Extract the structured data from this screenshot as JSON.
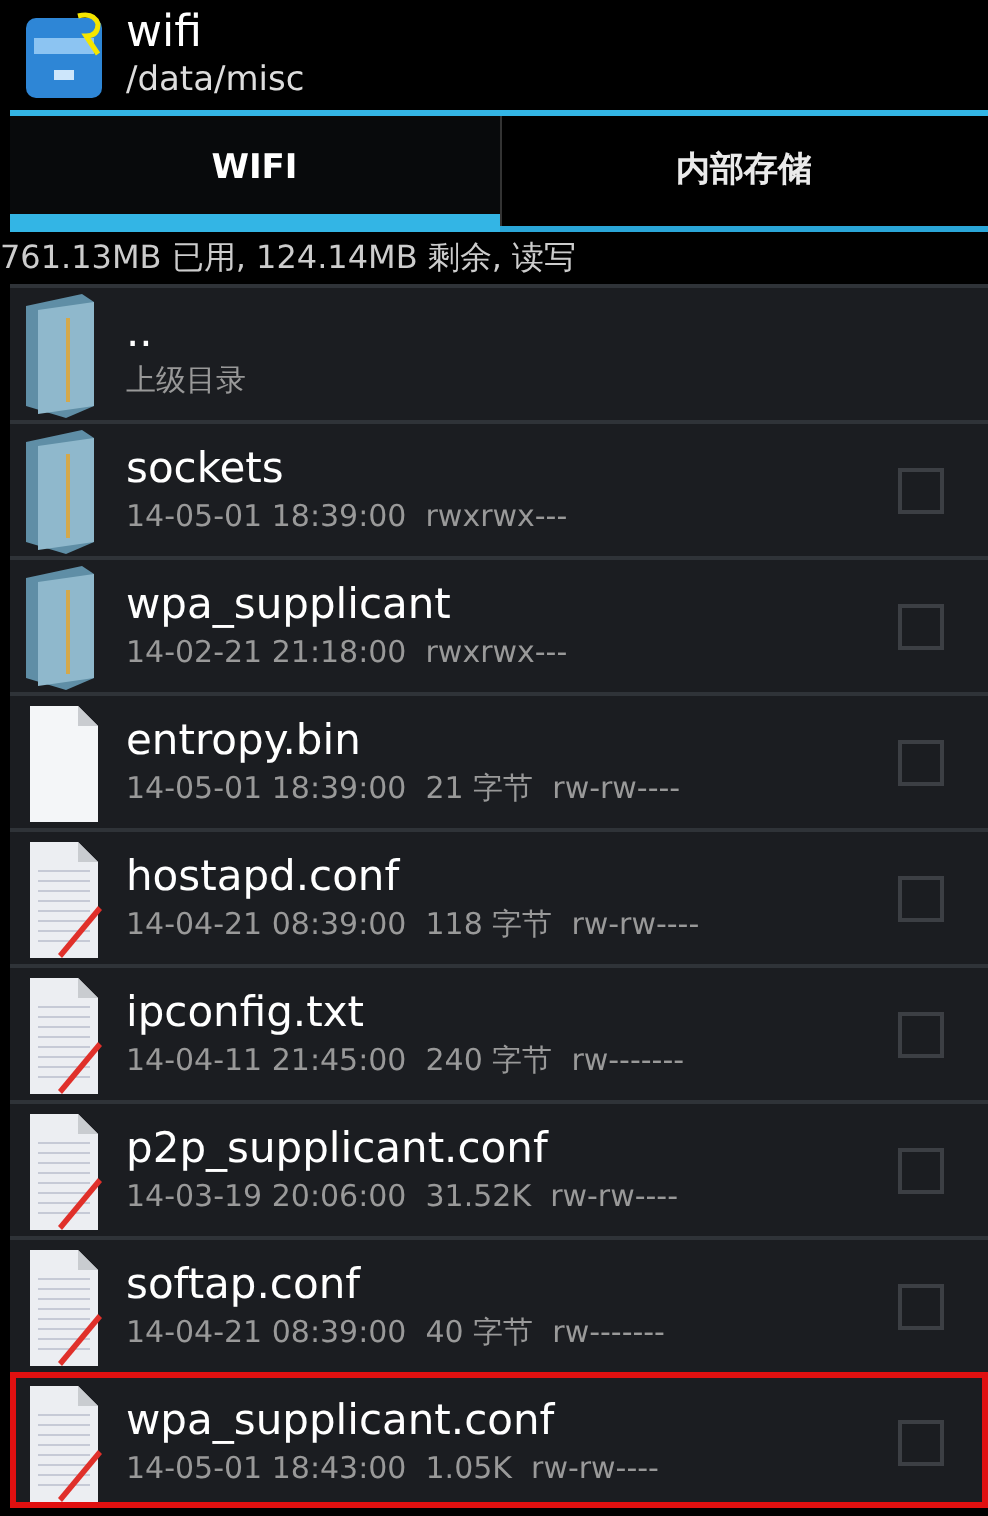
{
  "header": {
    "title": "wifi",
    "path": "/data/misc"
  },
  "tabs": [
    {
      "label": "WIFI",
      "selected": true
    },
    {
      "label": "内部存储",
      "selected": false
    }
  ],
  "storage_info": "761.13MB 已用, 124.14MB 剩余, 读写",
  "files": [
    {
      "kind": "up",
      "name": "..",
      "details": "上级目录",
      "highlighted": false
    },
    {
      "kind": "folder",
      "name": "sockets",
      "details": "14-05-01 18:39:00  rwxrwx---",
      "checked": false,
      "highlighted": false
    },
    {
      "kind": "folder",
      "name": "wpa_supplicant",
      "details": "14-02-21 21:18:00  rwxrwx---",
      "checked": false,
      "highlighted": false
    },
    {
      "kind": "file",
      "name": "entropy.bin",
      "details": "14-05-01 18:39:00  21 字节  rw-rw----",
      "checked": false,
      "highlighted": false
    },
    {
      "kind": "text",
      "name": "hostapd.conf",
      "details": "14-04-21 08:39:00  118 字节  rw-rw----",
      "checked": false,
      "highlighted": false
    },
    {
      "kind": "text",
      "name": "ipconfig.txt",
      "details": "14-04-11 21:45:00  240 字节  rw-------",
      "checked": false,
      "highlighted": false
    },
    {
      "kind": "text",
      "name": "p2p_supplicant.conf",
      "details": "14-03-19 20:06:00  31.52K  rw-rw----",
      "checked": false,
      "highlighted": false
    },
    {
      "kind": "text",
      "name": "softap.conf",
      "details": "14-04-21 08:39:00  40 字节  rw-------",
      "checked": false,
      "highlighted": false
    },
    {
      "kind": "text",
      "name": "wpa_supplicant.conf",
      "details": "14-05-01 18:43:00  1.05K  rw-rw----",
      "checked": false,
      "highlighted": true
    }
  ]
}
